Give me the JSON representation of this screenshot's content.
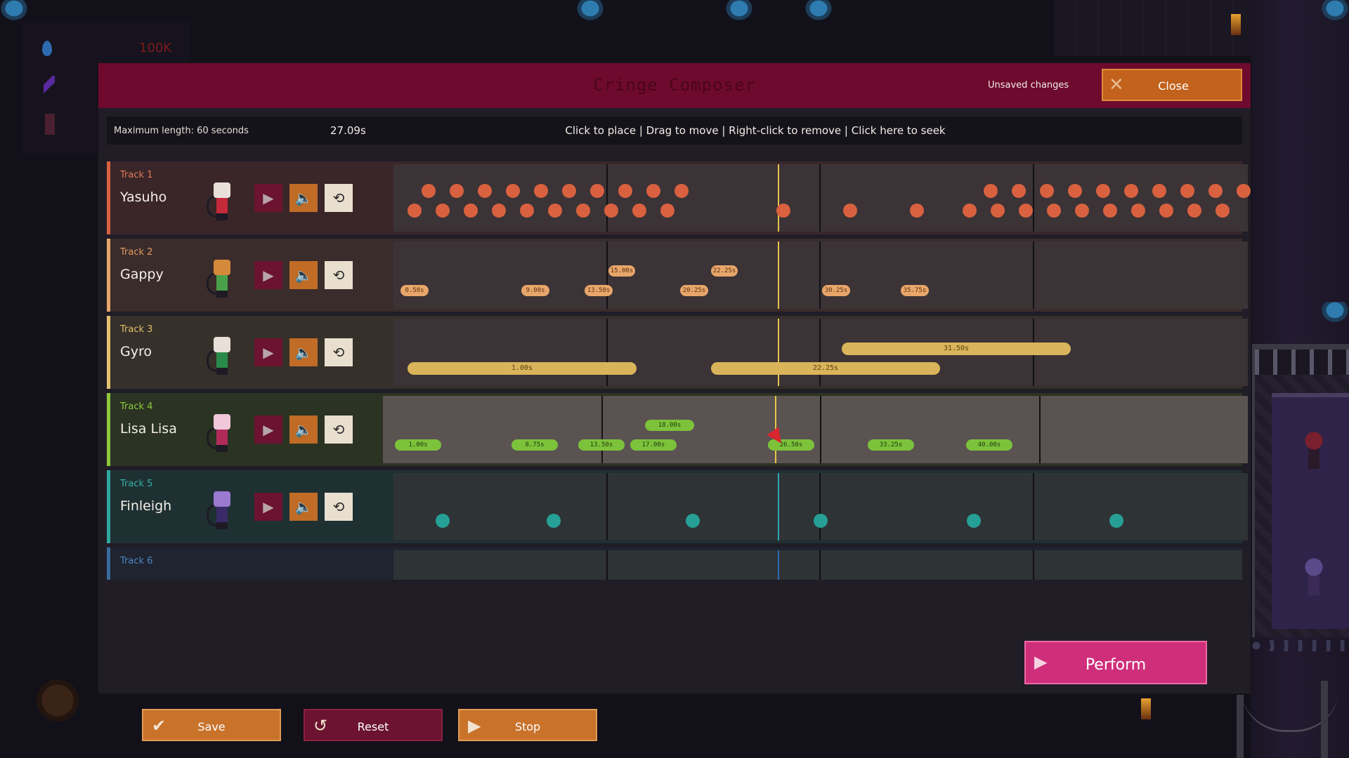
{
  "hud": {
    "currency_value": "100K"
  },
  "composer": {
    "title": "Cringe Composer",
    "unsaved_label": "Unsaved changes",
    "close_label": "Close",
    "max_length_label": "Maximum length: 60 seconds",
    "current_time": "27.09s",
    "instructions": "Click to place | Drag to move | Right-click to remove | Click here to seek"
  },
  "tracks": [
    {
      "num": "Track 1",
      "name": "Yasuho",
      "accent": "#d9613f",
      "num_color": "#e07a55",
      "row_bg": "#3a2629",
      "note_style": "dot",
      "notes_top": [],
      "notes_bottom": []
    },
    {
      "num": "Track 2",
      "name": "Gappy",
      "accent": "#e8a66a",
      "num_color": "#e49a5e",
      "row_bg": "#3a2c2b",
      "note_style": "pill",
      "notes_top": [
        "15.00s",
        "22.25s"
      ],
      "notes_bottom": [
        "0.50s",
        "9.00s",
        "13.50s",
        "20.25s",
        "30.25s",
        "35.75s"
      ]
    },
    {
      "num": "Track 3",
      "name": "Gyro",
      "accent": "#e2c070",
      "num_color": "#e2bf6a",
      "row_bg": "#35302a",
      "note_style": "bar",
      "notes_top": [
        "31.50s"
      ],
      "notes_bottom": [
        "1.00s",
        "22.25s"
      ]
    },
    {
      "num": "Track 4",
      "name": "Lisa Lisa",
      "accent": "#8ec63a",
      "num_color": "#8ecb3f",
      "row_bg": "#2b3322",
      "note_style": "pill",
      "notes_top": [
        "18.00s"
      ],
      "notes_bottom": [
        "1.00s",
        "8.75s",
        "13.50s",
        "17.00s",
        "26.50s",
        "33.25s",
        "40.00s"
      ]
    },
    {
      "num": "Track 5",
      "name": "Finleigh",
      "accent": "#2ea69c",
      "num_color": "#34b0a6",
      "row_bg": "#1f3032",
      "note_style": "dot",
      "notes_top": [],
      "notes_bottom": []
    },
    {
      "num": "Track 6",
      "name": "",
      "accent": "#3a6a9a",
      "num_color": "#4d86c4",
      "row_bg": "#1f2430",
      "note_style": "none",
      "notes_top": [],
      "notes_bottom": []
    }
  ],
  "footer": {
    "save_label": "Save",
    "reset_label": "Reset",
    "stop_label": "Stop",
    "perform_label": "Perform"
  },
  "icons": {
    "close": "x-icon",
    "play": "play-icon",
    "mute": "speaker-icon",
    "loop": "loop-icon",
    "save": "check-icon",
    "reset": "reset-icon",
    "stop": "play-icon",
    "perform": "play-icon"
  },
  "colors": {
    "title_bar": "#6e0a2d",
    "close_button": "#c2621d",
    "save_button": "#c8722a",
    "reset_button": "#6b1330",
    "stop_button": "#c8722a",
    "perform_button": "#cf2f7a",
    "playhead": "#e8c44a"
  }
}
